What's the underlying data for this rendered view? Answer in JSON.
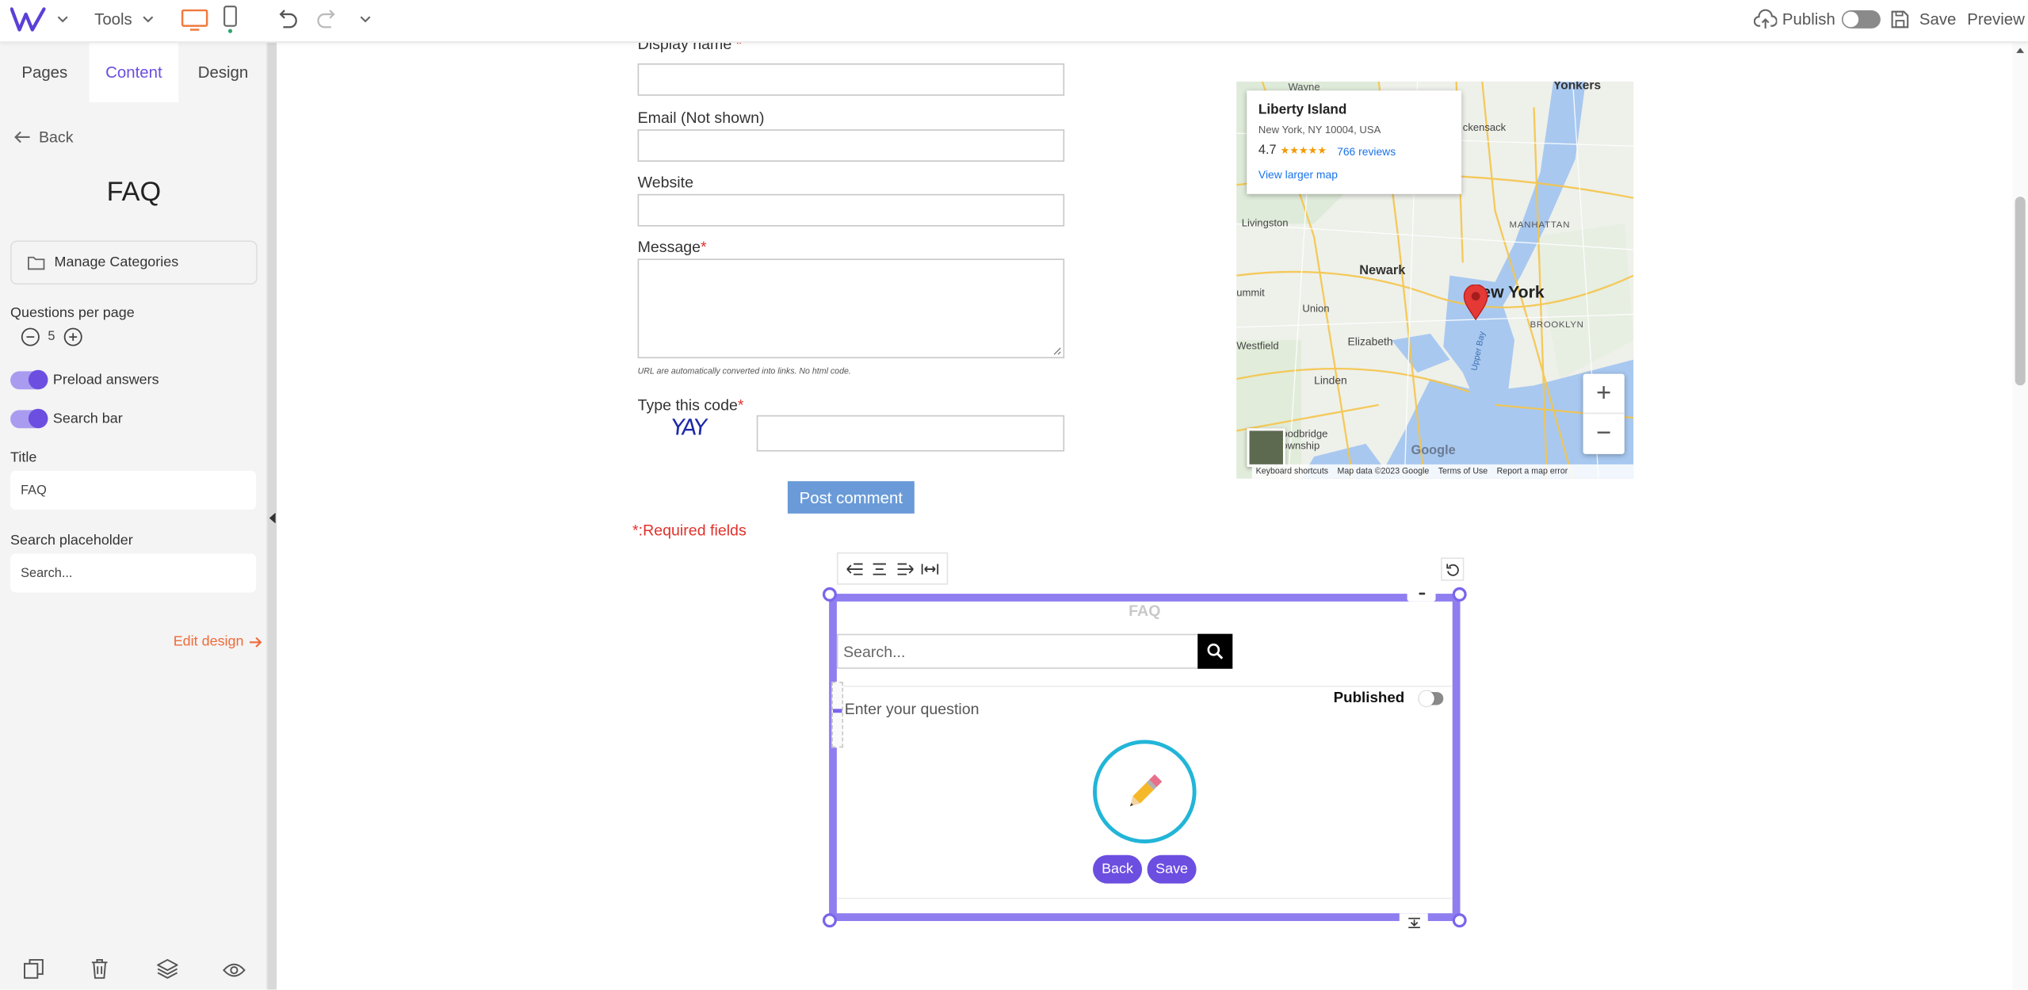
{
  "topbar": {
    "tools_label": "Tools",
    "publish_label": "Publish",
    "save_label": "Save",
    "preview_label": "Preview"
  },
  "sidebar": {
    "tabs": [
      {
        "label": "Pages"
      },
      {
        "label": "Content"
      },
      {
        "label": "Design"
      }
    ],
    "back_label": "Back",
    "section_title": "FAQ",
    "manage_categories_label": "Manage Categories",
    "questions_per_page_label": "Questions per page",
    "questions_per_page_value": "5",
    "preload_answers_label": "Preload answers",
    "search_bar_label": "Search bar",
    "title_label": "Title",
    "title_value": "FAQ",
    "search_placeholder_label": "Search placeholder",
    "search_placeholder_value": "Search...",
    "edit_design_label": "Edit design"
  },
  "comment_form": {
    "display_name_label": "Display name",
    "email_label": "Email (Not shown)",
    "website_label": "Website",
    "message_label": "Message",
    "required_star": "*",
    "url_note": "URL are automatically converted into links. No html code.",
    "code_label": "Type this code",
    "captcha_text": "YAY",
    "post_button": "Post comment",
    "required_note": "*:Required fields"
  },
  "map": {
    "place_title": "Liberty Island",
    "place_address": "New York, NY 10004, USA",
    "rating": "4.7",
    "stars": "★★★★★",
    "reviews_link": "766 reviews",
    "larger_map_link": "View larger map",
    "labels": {
      "wayne": "Wayne",
      "yonkers": "Yonkers",
      "hackensack": "ckensack",
      "livingston": "Livingston",
      "manhattan": "MANHATTAN",
      "newark": "Newark",
      "new_york": "New York",
      "summit": "ummit",
      "union": "Union",
      "elizabeth": "Elizabeth",
      "brooklyn": "BROOKLYN",
      "westfield": "Westfield",
      "linden": "Linden",
      "woodbridge": "oodbridge\nownship",
      "upper_bay": "Upper Bay",
      "google": "Google"
    },
    "zoom_in": "+",
    "zoom_out": "−",
    "footer": {
      "shortcuts": "Keyboard shortcuts",
      "map_data": "Map data ©2023 Google",
      "terms": "Terms of Use",
      "report": "Report a map error"
    }
  },
  "faq_widget": {
    "title": "FAQ",
    "search_placeholder": "Search...",
    "question_placeholder": "Enter your question",
    "published_label": "Published",
    "back_button": "Back",
    "save_button": "Save",
    "more_glyph": "•••"
  },
  "colors": {
    "accent": "#6c4ee0",
    "selection": "#8e7ef0",
    "required": "#e0312b",
    "post_button": "#6a9bd8",
    "edit_design": "#f06a3a"
  }
}
